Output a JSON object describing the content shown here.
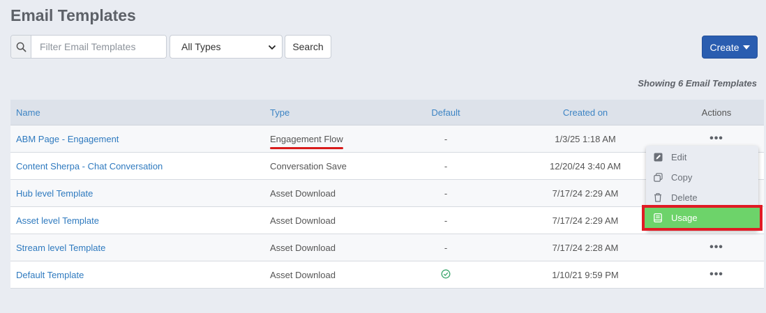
{
  "page": {
    "title": "Email Templates"
  },
  "toolbar": {
    "search_placeholder": "Filter Email Templates",
    "type_select_value": "All Types",
    "search_button": "Search",
    "create_button": "Create"
  },
  "summary": {
    "showing": "Showing 6 Email Templates"
  },
  "table": {
    "columns": {
      "name": "Name",
      "type": "Type",
      "default": "Default",
      "created": "Created on",
      "actions": "Actions"
    },
    "rows": [
      {
        "name": "ABM Page - Engagement",
        "type": "Engagement Flow",
        "default": "-",
        "created": "1/3/25 1:18 AM",
        "actions": "•••"
      },
      {
        "name": "Content Sherpa - Chat Conversation",
        "type": "Conversation Save",
        "default": "-",
        "created": "12/20/24 3:40 AM",
        "actions": ""
      },
      {
        "name": "Hub level Template",
        "type": "Asset Download",
        "default": "-",
        "created": "7/17/24 2:29 AM",
        "actions": ""
      },
      {
        "name": "Asset level Template",
        "type": "Asset Download",
        "default": "-",
        "created": "7/17/24 2:29 AM",
        "actions": ""
      },
      {
        "name": "Stream level Template",
        "type": "Asset Download",
        "default": "-",
        "created": "7/17/24 2:28 AM",
        "actions": "•••"
      },
      {
        "name": "Default Template",
        "type": "Asset Download",
        "default": "check-circle-icon",
        "created": "1/10/21 9:59 PM",
        "actions": "•••"
      }
    ]
  },
  "actions_menu": {
    "items": [
      {
        "label": "Edit",
        "icon": "edit-icon"
      },
      {
        "label": "Copy",
        "icon": "copy-icon"
      },
      {
        "label": "Delete",
        "icon": "trash-icon"
      },
      {
        "label": "Usage",
        "icon": "book-icon"
      }
    ]
  },
  "colors": {
    "primary": "#2a5db0",
    "link": "#2f7abf",
    "highlight": "#6dd36a",
    "annotation": "#e01b24",
    "check": "#3aa76d"
  }
}
